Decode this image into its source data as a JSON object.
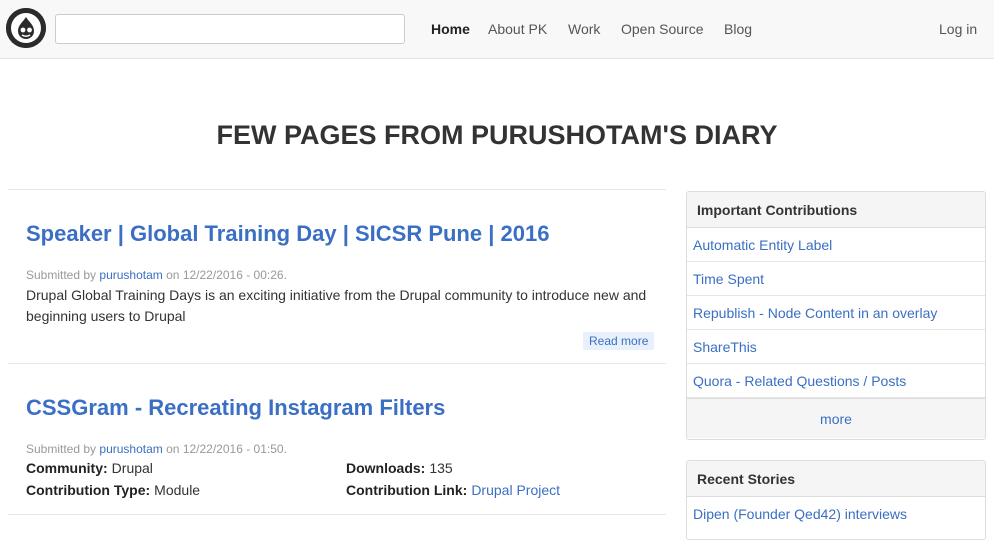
{
  "header": {
    "logo_icon": "drupal-drop-icon",
    "search": {
      "value": "",
      "placeholder": ""
    },
    "nav": [
      "Home",
      "About PK",
      "Work",
      "Open Source",
      "Blog"
    ],
    "login": "Log in"
  },
  "page_title": "FEW PAGES FROM PURUSHOTAM'S DIARY",
  "articles": [
    {
      "title": "Speaker | Global Training Day | SICSR Pune | 2016",
      "submitted_by": "Submitted by",
      "author": "purushotam",
      "on": "on",
      "date": "12/22/2016 - 00:26.",
      "summary": "Drupal Global Training Days is an exciting initiative from the Drupal community to introduce new and beginning users to Drupal",
      "read_more": "Read more"
    },
    {
      "title": "CSSGram - Recreating Instagram Filters",
      "submitted_by": "Submitted by",
      "author": "purushotam",
      "on": "on",
      "date": "12/22/2016 - 01:50.",
      "fields": {
        "community_label": "Community:",
        "community_value": "Drupal",
        "type_label": "Contribution Type:",
        "type_value": "Module",
        "downloads_label": "Downloads:",
        "downloads_value": "135",
        "link_label": "Contribution Link:",
        "link_value": "Drupal Project"
      }
    }
  ],
  "sidebar": {
    "contributions": {
      "heading": "Important Contributions",
      "items": [
        "Automatic Entity Label",
        "Time Spent",
        "Republish - Node Content in an overlay",
        "ShareThis",
        "Quora - Related Questions / Posts"
      ],
      "more": "more"
    },
    "stories": {
      "heading": "Recent Stories",
      "items": [
        "Dipen (Founder Qed42) interviews"
      ]
    }
  },
  "colors": {
    "link": "#3a6fc4",
    "navbar_bg": "#f8f8f8",
    "read_more_bg": "#e8f1fb"
  }
}
